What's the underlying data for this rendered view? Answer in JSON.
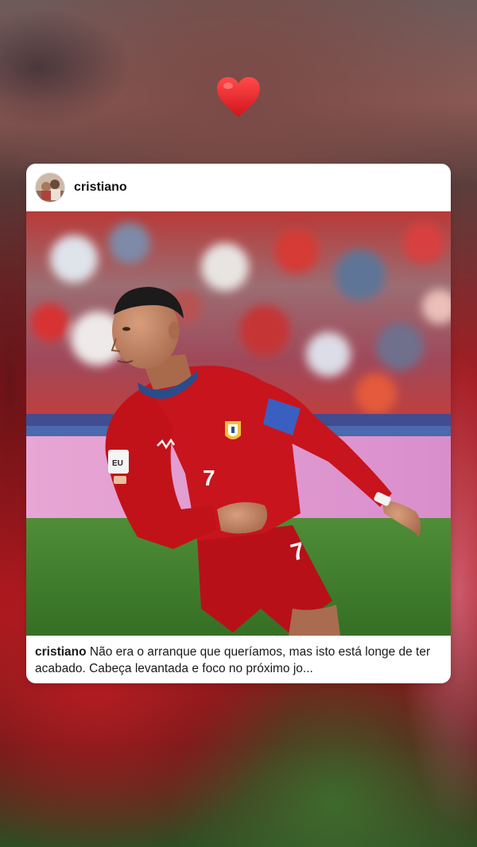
{
  "story": {
    "reaction": "heart-emoji"
  },
  "post": {
    "username": "cristiano",
    "caption_username": "cristiano",
    "caption_text": "Não era o arranque que queríamos, mas isto está longe de ter acabado. Cabeça levantada e foco no próximo jo...",
    "jersey_number": "7"
  },
  "colors": {
    "heart": "#e8212b",
    "jersey": "#c8141c",
    "pitch": "#3f7c2c",
    "card_bg": "#ffffff"
  }
}
